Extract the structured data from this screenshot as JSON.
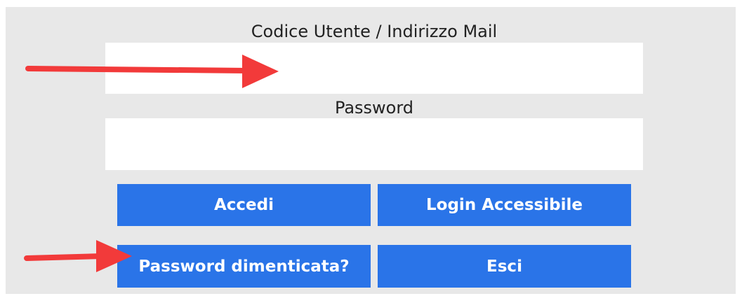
{
  "login_form": {
    "user_label": "Codice Utente / Indirizzo Mail",
    "user_value": "",
    "password_label": "Password",
    "password_value": ""
  },
  "buttons": {
    "login": "Accedi",
    "accessible_login": "Login Accessibile",
    "forgot_password": "Password dimenticata?",
    "exit": "Esci"
  },
  "colors": {
    "panel_background": "#e8e8e8",
    "button_background": "#2a74e8",
    "button_text": "#ffffff",
    "annotation_arrow": "#f23a3a"
  },
  "annotations": [
    {
      "name": "arrow-to-user-field",
      "icon": "right-arrow-icon"
    },
    {
      "name": "arrow-to-forgot-password",
      "icon": "right-arrow-icon"
    }
  ]
}
